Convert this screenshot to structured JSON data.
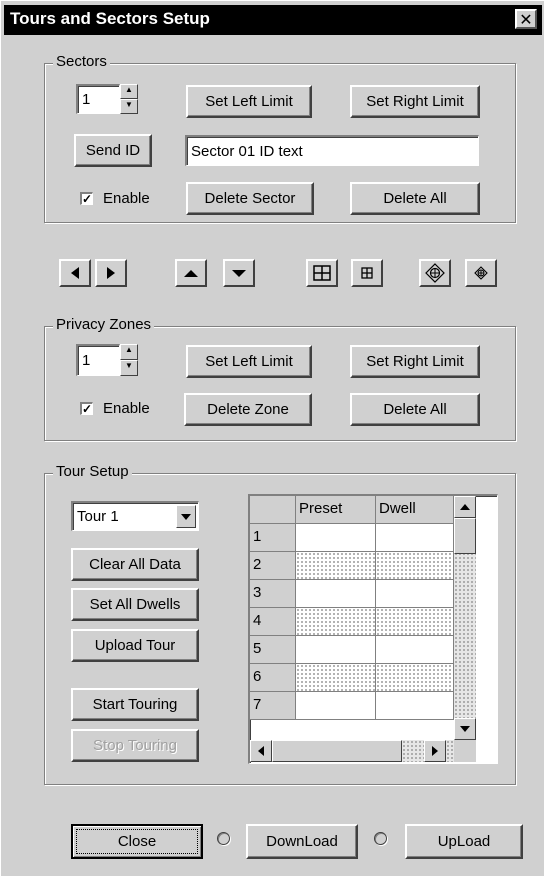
{
  "window": {
    "title": "Tours and Sectors Setup",
    "close_glyph": "✕"
  },
  "sectors": {
    "legend": "Sectors",
    "number": "1",
    "set_left_limit": "Set Left Limit",
    "set_right_limit": "Set Right Limit",
    "send_id": "Send ID",
    "id_text": "Sector 01 ID text",
    "enable_label": "Enable",
    "enable_checked": true,
    "delete_sector": "Delete Sector",
    "delete_all": "Delete All"
  },
  "ptz_controls": [
    "pan-left",
    "pan-right",
    "tilt-up",
    "tilt-down",
    "zoom-in",
    "zoom-out",
    "focus-near",
    "focus-far"
  ],
  "privacy": {
    "legend": "Privacy Zones",
    "number": "1",
    "set_left_limit": "Set Left Limit",
    "set_right_limit": "Set Right Limit",
    "enable_label": "Enable",
    "enable_checked": true,
    "delete_zone": "Delete Zone",
    "delete_all": "Delete All"
  },
  "tour": {
    "legend": "Tour Setup",
    "selected_tour": "Tour 1",
    "clear_all_data": "Clear All Data",
    "set_all_dwells": "Set All Dwells",
    "upload_tour": "Upload Tour",
    "start_touring": "Start Touring",
    "stop_touring": "Stop Touring",
    "grid": {
      "columns": [
        "Preset",
        "Dwell"
      ],
      "rows": [
        "1",
        "2",
        "3",
        "4",
        "5",
        "6",
        "7"
      ]
    }
  },
  "footer": {
    "close": "Close",
    "download": "DownLoad",
    "upload": "UpLoad"
  },
  "colors": {
    "face": "#d0d0d0",
    "titlebar": "#000000",
    "title_text": "#ffffff"
  }
}
